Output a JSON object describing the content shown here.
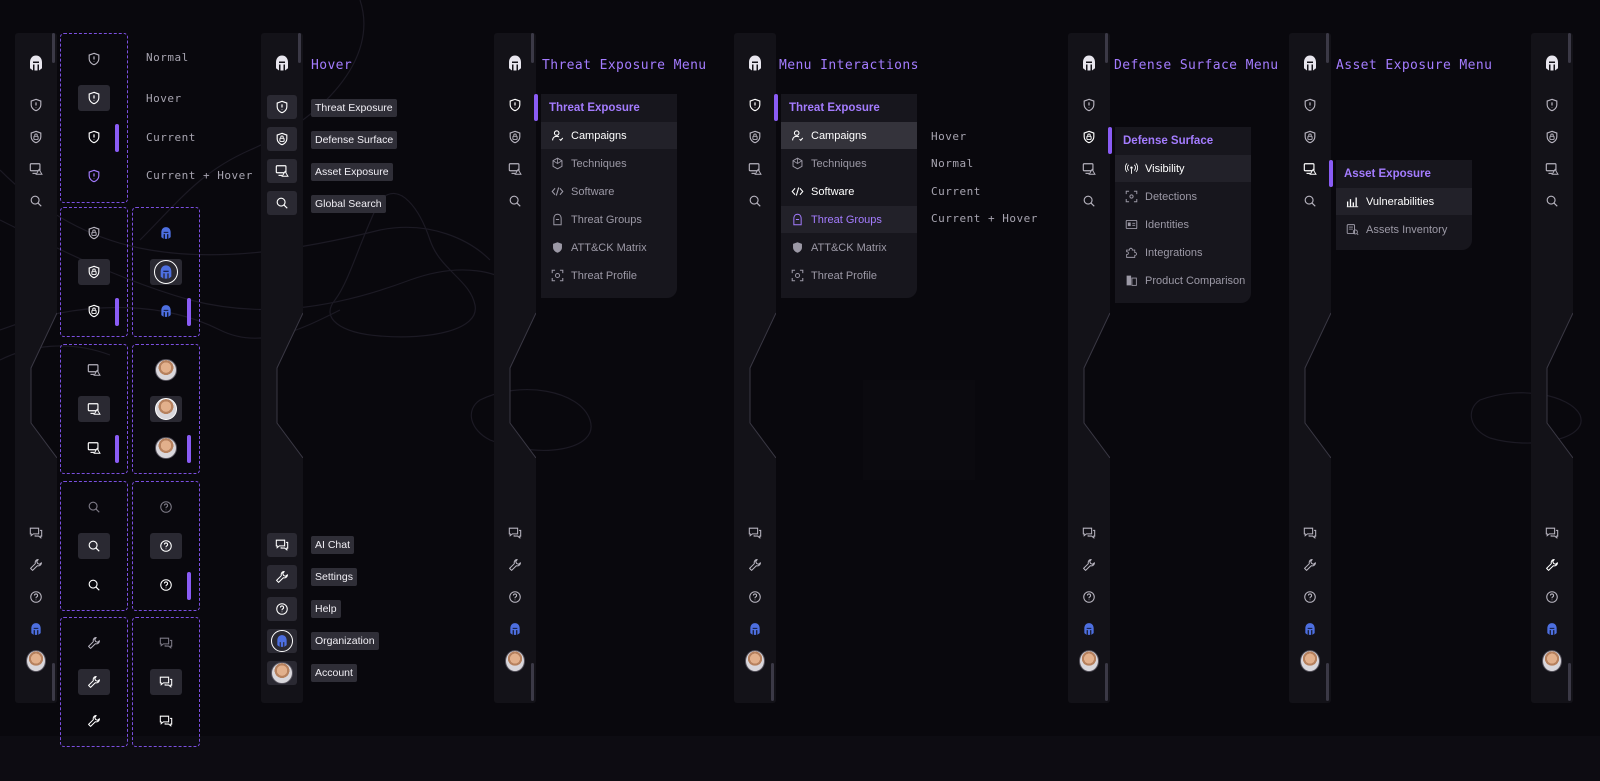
{
  "states": {
    "normal": "Normal",
    "hover": "Hover",
    "current": "Current",
    "current_hover": "Current + Hover"
  },
  "headings": {
    "hover": "Hover",
    "threat_menu": "Threat Exposure Menu",
    "interactions": "Menu Interactions",
    "defense_menu": "Defense Surface Menu",
    "asset_menu": "Asset Exposure Menu"
  },
  "tooltips": {
    "threat": "Threat Exposure",
    "defense": "Defense Surface",
    "asset": "Asset Exposure",
    "search": "Global Search",
    "chat": "AI Chat",
    "settings": "Settings",
    "help": "Help",
    "org": "Organization",
    "account": "Account"
  },
  "menus": {
    "threat": {
      "title": "Threat Exposure",
      "items": [
        "Campaigns",
        "Techniques",
        "Software",
        "Threat Groups",
        "ATT&CK Matrix",
        "Threat Profile"
      ]
    },
    "defense": {
      "title": "Defense Surface",
      "items": [
        "Visibility",
        "Detections",
        "Identities",
        "Integrations",
        "Product Comparison"
      ]
    },
    "asset": {
      "title": "Asset Exposure",
      "items": [
        "Vulnerabilities",
        "Assets Inventory"
      ]
    }
  },
  "interaction_labels": [
    "Hover",
    "Normal",
    "Current",
    "Current + Hover"
  ],
  "colors": {
    "accent": "#8a5cf5",
    "accent_text": "#a47cff",
    "background": "#09080d",
    "rail": "#131218"
  }
}
